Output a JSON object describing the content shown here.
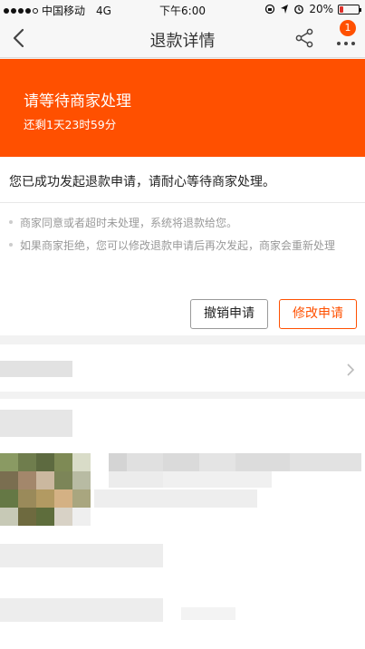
{
  "status_bar": {
    "carrier": "中国移动",
    "network": "4G",
    "time": "下午6:00",
    "battery_text": "20%",
    "battery_level": 0.2,
    "battery_color": "#e0312b"
  },
  "nav": {
    "title": "退款详情",
    "badge_count": "1",
    "icons": [
      "chevron-left-icon",
      "share-icon",
      "more-icon"
    ]
  },
  "banner": {
    "heading": "请等待商家处理",
    "countdown": "还剩1天23时59分",
    "color": "#ff5000"
  },
  "info": {
    "message": "您已成功发起退款申请，请耐心等待商家处理。",
    "tips": [
      "商家同意或者超时未处理，系统将退款给您。",
      "如果商家拒绝，您可以修改退款申请后再次发起，商家会重新处理"
    ]
  },
  "actions": {
    "cancel_label": "撤销申请",
    "modify_label": "修改申请"
  },
  "colors": {
    "accent": "#ff5000",
    "background": "#f2f2f2"
  }
}
